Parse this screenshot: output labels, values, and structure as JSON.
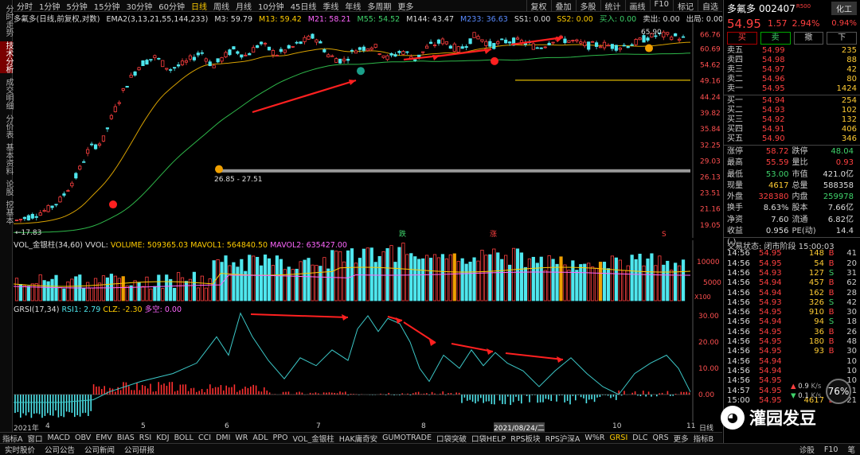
{
  "left_sidebar": [
    "分时走势",
    "技术分析",
    "成交明细",
    "分价表",
    "基本资料",
    "论股",
    "挖基本"
  ],
  "top_tabs": [
    "分时",
    "1分钟",
    "5分钟",
    "15分钟",
    "30分钟",
    "60分钟",
    "日线",
    "周线",
    "月线",
    "10分钟",
    "45日线",
    "季线",
    "年线",
    "多周期",
    "更多"
  ],
  "top_selected": "日线",
  "top_right": [
    "复权",
    "叠加",
    "多股",
    "统计",
    "画线",
    "F10",
    "标记",
    "自选"
  ],
  "info": {
    "title": "多氟多(日线,前复权,对数)",
    "ema_label": "EMA2(3,13,21,55,144,233)",
    "m3": "M3: 59.79",
    "m13": "M13: 59.42",
    "m21": "M21: 58.21",
    "m55": "M55: 54.52",
    "m144": "M144: 43.47",
    "m233": "M233: 36.63",
    "ss1": "SS1: 0.00",
    "ss2": "SS2: 0.00",
    "buy": "买入: 0.00",
    "sell": "卖出: 0.00",
    "out": "出局: 0.00"
  },
  "price_axis": [
    "66.76",
    "60.69",
    "54.62",
    "49.16",
    "44.24",
    "39.82",
    "35.84",
    "32.25",
    "29.03",
    "26.13",
    "23.51",
    "21.16",
    "19.05"
  ],
  "chart_labels": {
    "high": "65.90",
    "low": "17.83",
    "box": "26.85 - 27.51",
    "ann1": "跌",
    "ann2": "涨",
    "ann3": "S"
  },
  "vol_info": {
    "title": "VOL_金银柱(34,60)",
    "vvol": "VVOL:",
    "volume": "VOLUME: 509365.03",
    "mavol1": "MAVOL1: 564840.50",
    "mavol2": "MAVOL2: 635427.00"
  },
  "vol_axis": [
    "10000",
    "5000"
  ],
  "vol_unit": "X100",
  "rsi_info": {
    "title": "GRSI(17,34)",
    "rsi1": "RSI1: 2.79",
    "clz": "CLZ: -2.30",
    "dk": "多空: 0.00"
  },
  "rsi_axis": [
    "30.00",
    "20.00",
    "10.00",
    "0.00"
  ],
  "date_axis": [
    "2021年",
    "4",
    "5",
    "6",
    "7",
    "8",
    "2021/08/24/二",
    "10",
    "11"
  ],
  "timeframe": "日线",
  "indicator_tabs": [
    "指标A",
    "窗口",
    "MACD",
    "OBV",
    "EMV",
    "BIAS",
    "RSI",
    "KDJ",
    "BOLL",
    "CCI",
    "DMI",
    "WR",
    "ADL",
    "PPO",
    "VOL_金银柱",
    "HAK庸奇安",
    "GUMOTRADE",
    "口袋突破",
    "口袋HELP",
    "RPS板块",
    "RPS沪深A",
    "W%R",
    "GRSI",
    "DLC",
    "QRS",
    "更多",
    "指标B"
  ],
  "indicator_selected": "GRSI",
  "bottom_bar": [
    "实时股价",
    "公司公告",
    "公司新闻",
    "公司研报"
  ],
  "bottom_right": [
    "诊股",
    "F10",
    "笔"
  ],
  "stock": {
    "name": "多氟多",
    "code": "002407",
    "badge": "R500",
    "price": "54.95",
    "change": "1.57",
    "pct": "2.94%",
    "industry": "化工",
    "ind_pct": "0.94%"
  },
  "actions": [
    "买",
    "卖",
    "撤",
    "下"
  ],
  "sells": [
    {
      "label": "卖五",
      "price": "54.99",
      "vol": "235"
    },
    {
      "label": "卖四",
      "price": "54.98",
      "vol": "88"
    },
    {
      "label": "卖三",
      "price": "54.97",
      "vol": "42"
    },
    {
      "label": "卖二",
      "price": "54.96",
      "vol": "80"
    },
    {
      "label": "卖一",
      "price": "54.95",
      "vol": "1424"
    }
  ],
  "buys": [
    {
      "label": "买一",
      "price": "54.94",
      "vol": "254"
    },
    {
      "label": "买二",
      "price": "54.93",
      "vol": "102"
    },
    {
      "label": "买三",
      "price": "54.92",
      "vol": "132"
    },
    {
      "label": "买四",
      "price": "54.91",
      "vol": "406"
    },
    {
      "label": "买五",
      "price": "54.90",
      "vol": "346"
    }
  ],
  "stats": [
    [
      {
        "k": "涨停",
        "v": "58.72",
        "c": "red"
      },
      {
        "k": "跌停",
        "v": "48.04",
        "c": "grn"
      }
    ],
    [
      {
        "k": "最高",
        "v": "55.59",
        "c": "red"
      },
      {
        "k": "量比",
        "v": "0.93",
        "c": "red"
      }
    ],
    [
      {
        "k": "最低",
        "v": "53.00",
        "c": "grn"
      },
      {
        "k": "市值",
        "v": "421.0亿",
        "c": "wht"
      }
    ],
    [
      {
        "k": "现量",
        "v": "4617",
        "c": "yel"
      },
      {
        "k": "总量",
        "v": "588358",
        "c": "wht"
      }
    ],
    [
      {
        "k": "外盘",
        "v": "328380",
        "c": "red"
      },
      {
        "k": "内盘",
        "v": "259978",
        "c": "grn"
      }
    ],
    [
      {
        "k": "换手",
        "v": "8.63%",
        "c": "wht"
      },
      {
        "k": "股本",
        "v": "7.66亿",
        "c": "wht"
      }
    ],
    [
      {
        "k": "净资",
        "v": "7.60",
        "c": "wht"
      },
      {
        "k": "流通",
        "v": "6.82亿",
        "c": "wht"
      }
    ],
    [
      {
        "k": "收益(-)",
        "v": "0.956",
        "c": "wht"
      },
      {
        "k": "PE(动)",
        "v": "14.4",
        "c": "wht"
      }
    ]
  ],
  "trade_status": "交易状态: 闭市阶段 15:00:03",
  "ticks": [
    {
      "t": "14:56",
      "p": "54.95",
      "q": "148",
      "d": "B",
      "n": "41"
    },
    {
      "t": "14:56",
      "p": "54.95",
      "q": "54",
      "d": "B",
      "n": "20"
    },
    {
      "t": "14:56",
      "p": "54.93",
      "q": "127",
      "d": "S",
      "n": "31"
    },
    {
      "t": "14:56",
      "p": "54.94",
      "q": "457",
      "d": "B",
      "n": "62"
    },
    {
      "t": "14:56",
      "p": "54.94",
      "q": "162",
      "d": "B",
      "n": "28"
    },
    {
      "t": "14:56",
      "p": "54.93",
      "q": "326",
      "d": "S",
      "n": "42"
    },
    {
      "t": "14:56",
      "p": "54.95",
      "q": "910",
      "d": "B",
      "n": "30"
    },
    {
      "t": "14:56",
      "p": "54.94",
      "q": "94",
      "d": "S",
      "n": "18"
    },
    {
      "t": "14:56",
      "p": "54.95",
      "q": "36",
      "d": "B",
      "n": "26"
    },
    {
      "t": "14:56",
      "p": "54.95",
      "q": "180",
      "d": "B",
      "n": "48"
    },
    {
      "t": "14:56",
      "p": "54.95",
      "q": "93",
      "d": "B",
      "n": "30"
    },
    {
      "t": "14:56",
      "p": "54.94",
      "q": "",
      "d": "",
      "n": "10"
    },
    {
      "t": "14:56",
      "p": "54.94",
      "q": "",
      "d": "",
      "n": "10"
    },
    {
      "t": "14:56",
      "p": "54.95",
      "q": "",
      "d": "",
      "n": "10"
    },
    {
      "t": "14:57",
      "p": "54.95",
      "q": "",
      "d": "",
      "n": "21"
    },
    {
      "t": "15:00",
      "p": "54.95",
      "q": "4617",
      "d": "B",
      "n": "921"
    }
  ],
  "net": {
    "up": "0.9",
    "down": "0.1",
    "unit": "K/s"
  },
  "gauge": "76%",
  "watermark": "灌园发豆",
  "colors": {
    "up": "#ff4040",
    "down": "#3fd36b",
    "vol_cyan": "#4fe7ee",
    "accent": "#ffcc00"
  }
}
